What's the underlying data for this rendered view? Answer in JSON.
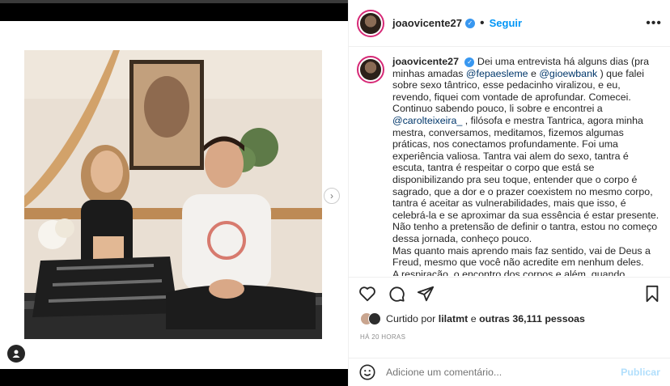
{
  "post": {
    "username": "joaovicente27",
    "follow_label": "Seguir",
    "more_label": "•••",
    "caption": {
      "username": "joaovicente27",
      "part1": "Dei uma entrevista há alguns dias (pra minhas amadas ",
      "mention1": "@fepaesleme",
      "part2": " e ",
      "mention2": "@gioewbank",
      "part3": " ) que falei sobre sexo tântrico, esse pedacinho viralizou, e eu, revendo, fiquei com vontade de aprofundar. Comecei. Continuo sabendo pouco, li sobre e encontrei a ",
      "mention3": "@carolteixeira_",
      "part4": " , filósofa e mestra Tantrica, agora minha mestra, conversamos, meditamos, fizemos algumas práticas, nos conectamos profundamente. Foi uma experiência valiosa. Tantra vai alem do sexo, tantra é escuta, tantra é respeitar o corpo que está se disponibilizando pra seu toque, entender que o corpo é sagrado, que a dor e o prazer coexistem no mesmo corpo, tantra é aceitar as vulnerabilidades, mais que isso, é celebrá-la e se aproximar da sua essência é estar presente.",
      "para2": "Não tenho a pretensão de definir o tantra, estou no começo dessa jornada, conheço pouco.",
      "para3": "Mas quanto mais aprendo mais faz sentido, vai de Deus a Freud, mesmo que você não acredite em nenhum deles.",
      "para4": "A respiração, o encontro dos corpos e além, quando aprofundamos, tantra é uma lição de vida, porque quando para"
    },
    "likes": {
      "prefix": "Curtido por",
      "user": "lilatmt",
      "middle": "e",
      "others": "outras 36,111 pessoas"
    },
    "time": "HÁ 20 HORAS",
    "comment_placeholder": "Adicione um comentário...",
    "publish_label": "Publicar",
    "icons": [
      "heart-icon",
      "comment-icon",
      "share-icon",
      "bookmark-icon",
      "emoji-icon",
      "chevron-right-icon",
      "user-tag-icon"
    ]
  }
}
